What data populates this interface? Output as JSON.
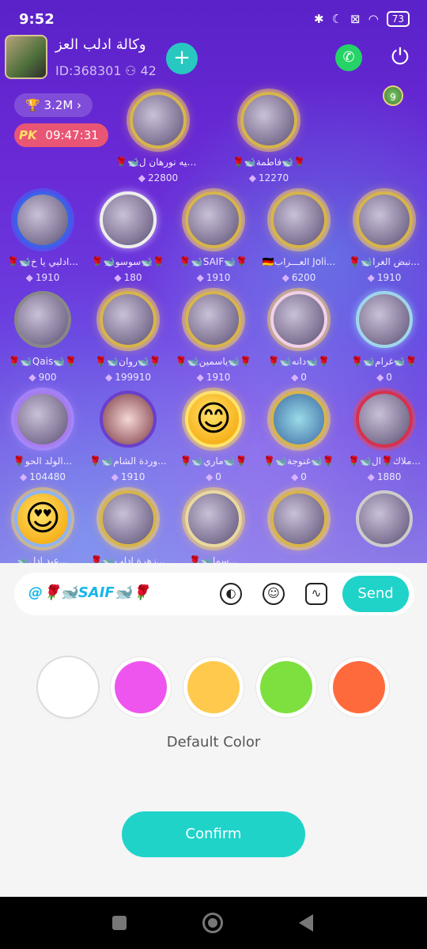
{
  "status_bar": {
    "time": "9:52",
    "battery": "73"
  },
  "room": {
    "name": "وكالة ادلب العز",
    "id_label": "ID:368301",
    "members": "42",
    "add_label": "+",
    "trophy": "3.2M",
    "pk_label": "PK",
    "pk_timer": "09:47:31",
    "level": "9"
  },
  "seats": [
    {
      "name": "🌹🐋الوكيه نورهان ل...",
      "score": "22800"
    },
    {
      "name": "🌹🐋فاطمة🐋🌹",
      "score": "12270"
    },
    {
      "name": "🌹🐋ادلبي يا خ...",
      "score": "1910"
    },
    {
      "name": "🌹🐋سوسو🐋🌹",
      "score": "180"
    },
    {
      "name": "🌹🐋SAIF🐋🌹",
      "score": "1910"
    },
    {
      "name": "🇩🇪العـــراب Joli...",
      "score": "6200"
    },
    {
      "name": "🌹🐋نبض الغرا...",
      "score": "1910"
    },
    {
      "name": "🌹🐋Qais🐋🌹",
      "score": "900"
    },
    {
      "name": "🌹🐋روان🐋🌹",
      "score": "199910"
    },
    {
      "name": "🌹🐋ياسمين🐋🌹",
      "score": "1910"
    },
    {
      "name": "🌹🐋دانه🐋🌹",
      "score": "0"
    },
    {
      "name": "🌹🐋غرام🐋🌹",
      "score": "0"
    },
    {
      "name": "🌹الولد الحو...",
      "score": "104480"
    },
    {
      "name": "🌹🐋وردة الشام...",
      "score": "1910"
    },
    {
      "name": "🌹🐋ماري🐋🌹",
      "score": "0"
    },
    {
      "name": "🌹🐋غنوجة🐋🌹",
      "score": "0"
    },
    {
      "name": "🌹🐋ملاك🌹ال...",
      "score": "1880"
    },
    {
      "name": "🐋عبد ادل...",
      "score": ""
    },
    {
      "name": "🌹🐋زهرة ادلب...",
      "score": ""
    },
    {
      "name": "🌹🐋سما...",
      "score": ""
    }
  ],
  "composer": {
    "input_value": "@🌹🐋SAIF🐋🌹",
    "send_label": "Send"
  },
  "colors": {
    "options": [
      "#ffffff",
      "#ee55ee",
      "#ffc94d",
      "#7ee03f",
      "#ff6a3d"
    ],
    "selected_label": "Default Color"
  },
  "confirm_label": "Confirm"
}
